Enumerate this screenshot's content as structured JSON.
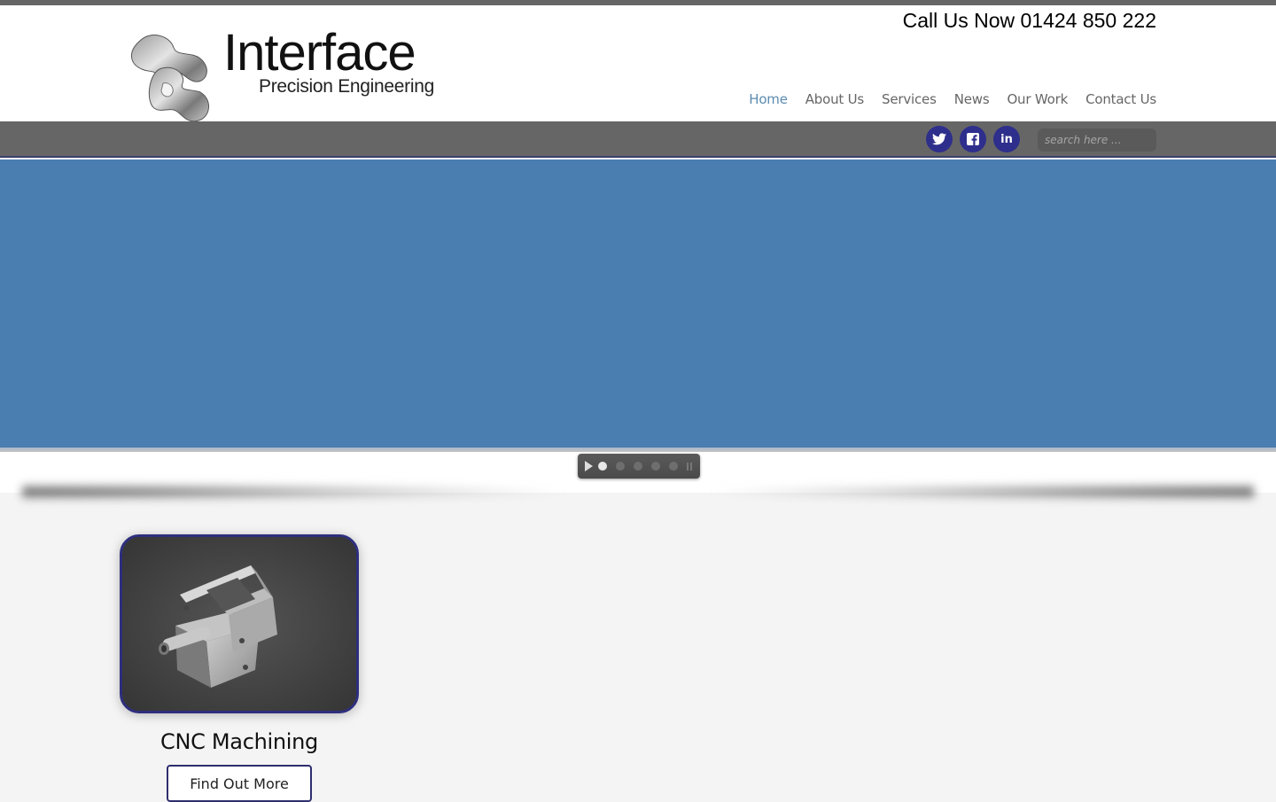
{
  "header": {
    "logo_name": "Interface",
    "logo_tagline": "Precision Engineering",
    "phone": "Call Us Now 01424 850 222"
  },
  "nav": {
    "active": "Home",
    "items": [
      {
        "label": "Home"
      },
      {
        "label": "About Us"
      },
      {
        "label": "Services"
      },
      {
        "label": "News"
      },
      {
        "label": "Our Work"
      },
      {
        "label": "Contact Us"
      }
    ]
  },
  "social": {
    "twitter_glyph": "🐦",
    "facebook_glyph": "f",
    "linkedin_glyph": "in",
    "color": "#2e2e8c"
  },
  "search": {
    "placeholder": "search here ...",
    "value": ""
  },
  "slider": {
    "background": "#4a7db0",
    "slide_count": 5,
    "active_slide": 1
  },
  "cards": [
    {
      "title": "CNC Machining",
      "button_label": "Find Out More",
      "image_alt": "machined metal part on granite"
    }
  ]
}
